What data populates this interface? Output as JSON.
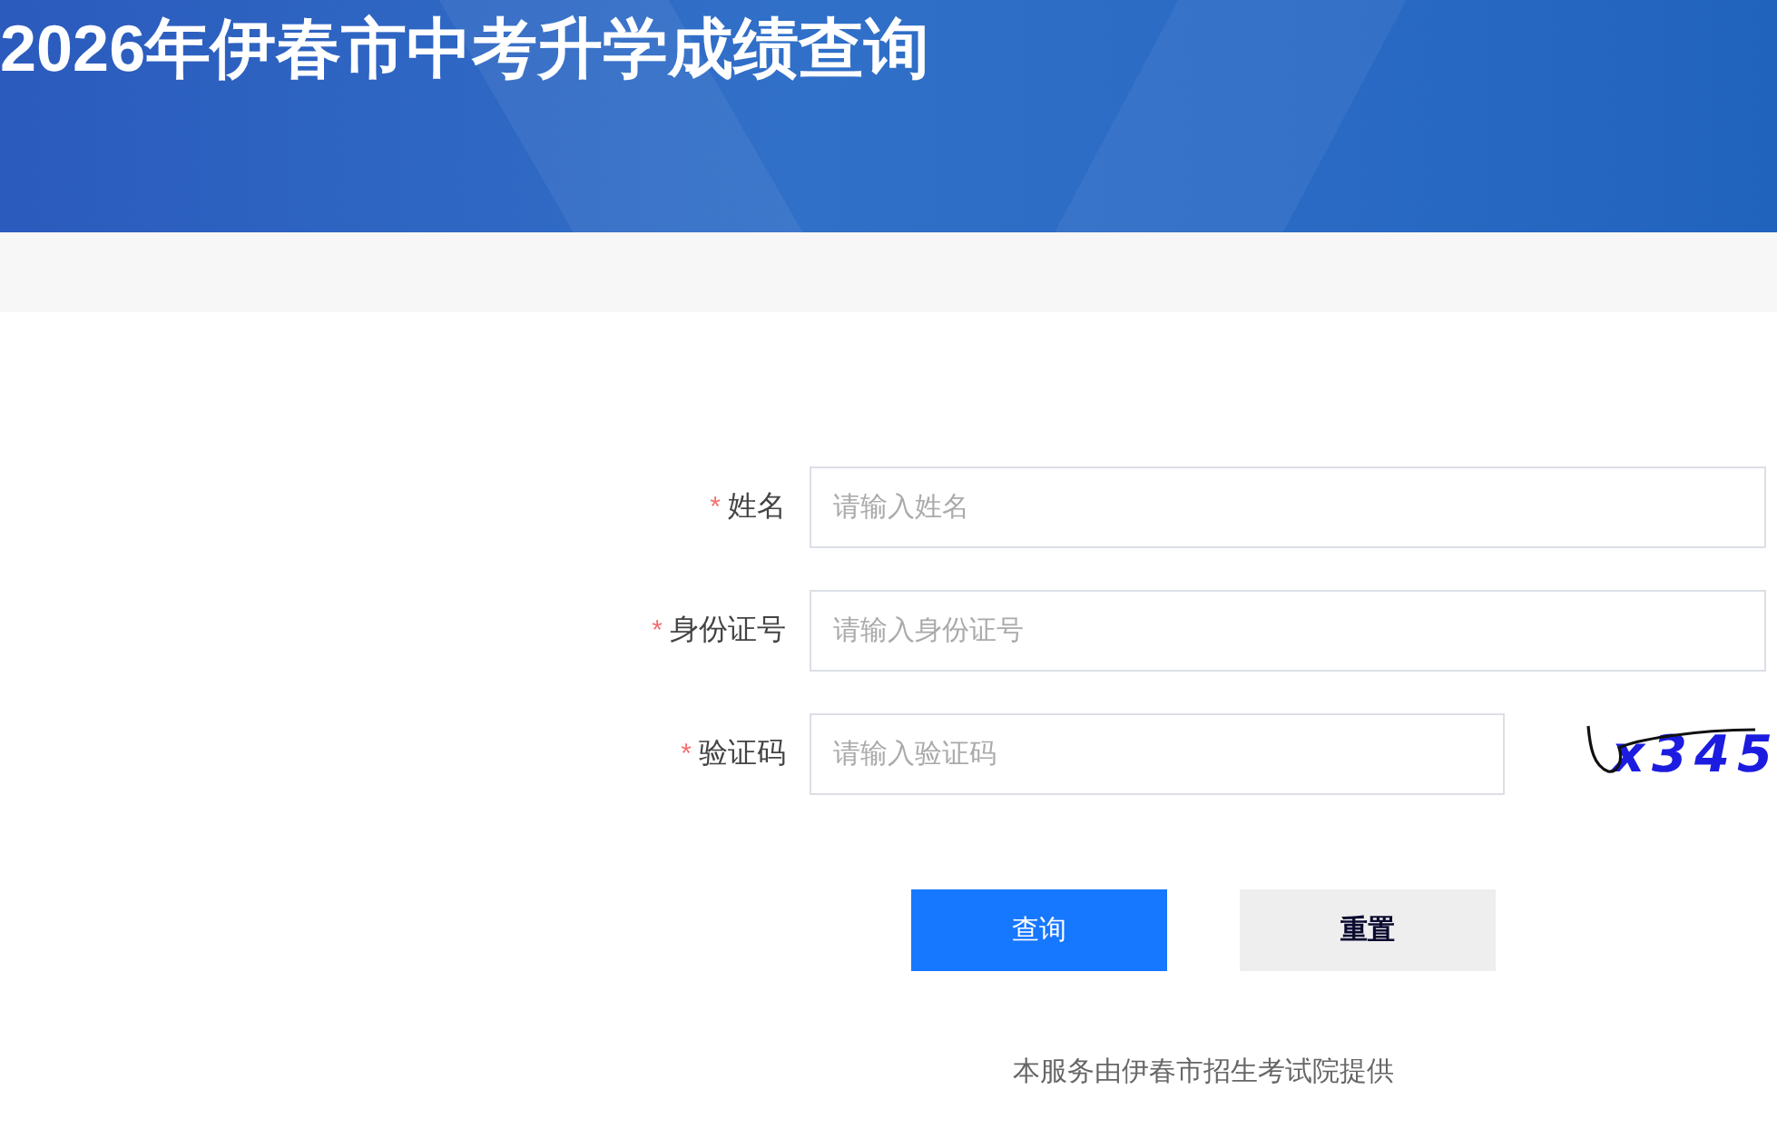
{
  "header": {
    "title": "2026年伊春市中考升学成绩查询"
  },
  "form": {
    "fields": [
      {
        "kind": "text",
        "required_mark": "*",
        "label": "姓名",
        "placeholder": "请输入姓名"
      },
      {
        "kind": "text",
        "required_mark": "*",
        "label": "身份证号",
        "placeholder": "请输入身份证号"
      },
      {
        "kind": "captcha",
        "required_mark": "*",
        "label": "验证码",
        "placeholder": "请输入验证码",
        "captcha": "x345"
      }
    ]
  },
  "buttons": [
    {
      "kind": "primary",
      "label": "查询"
    },
    {
      "kind": "default",
      "label": "重置"
    }
  ],
  "footer": {
    "text": "本服务由伊春市招生考试院提供"
  }
}
